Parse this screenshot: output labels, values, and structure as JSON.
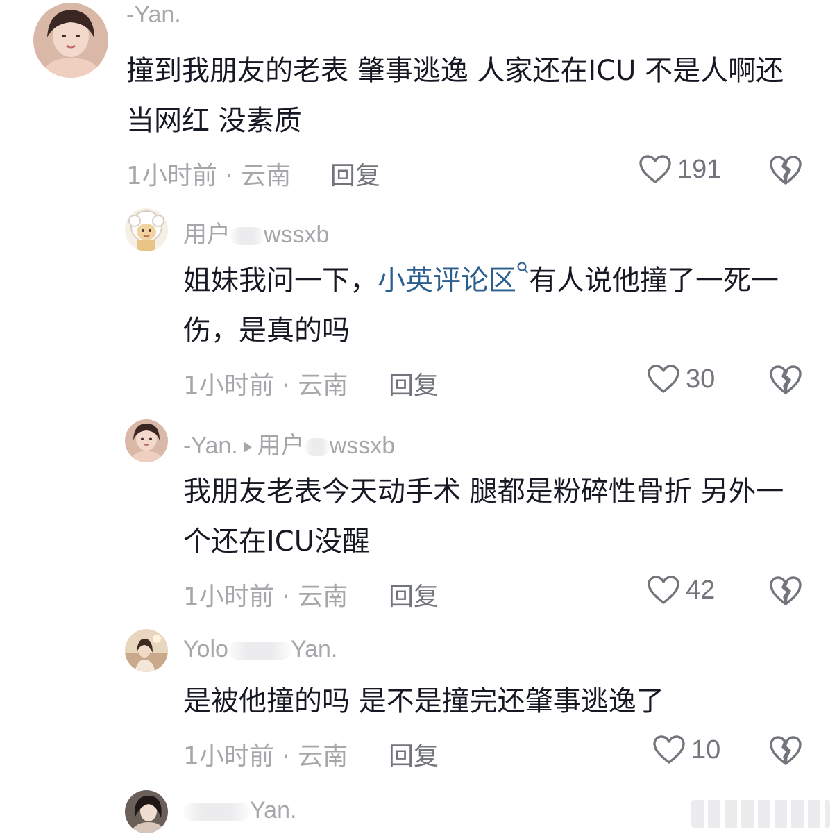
{
  "comments": [
    {
      "username": "-Yan.",
      "content": "撞到我朋友的老表 肇事逃逸 人家还在ICU 不是人啊还当网红 没素质",
      "meta": "1小时前 · 云南",
      "reply_label": "回复",
      "likes": "191",
      "avatar_icon": "user-avatar"
    },
    {
      "username_prefix": "用户",
      "username_suffix": "wssxb",
      "content_before": "姐妹我问一下，",
      "mention": "小英评论区",
      "content_after": "有人说他撞了一死一伤，是真的吗",
      "meta": "1小时前 · 云南",
      "reply_label": "回复",
      "likes": "30",
      "avatar_icon": "sheep-avatar"
    },
    {
      "username": "-Yan.",
      "reply_to_prefix": "用户",
      "reply_to_suffix": "wssxb",
      "content": "我朋友老表今天动手术 腿都是粉碎性骨折 另外一个还在ICU没醒",
      "meta": "1小时前 · 云南",
      "reply_label": "回复",
      "likes": "42",
      "avatar_icon": "user-avatar"
    },
    {
      "username_prefix": "Yolo",
      "username_suffix": "Yan.",
      "content": "是被他撞的吗 是不是撞完还肇事逃逸了",
      "meta": "1小时前 · 云南",
      "reply_label": "回复",
      "likes": "10",
      "avatar_icon": "user-avatar"
    },
    {
      "username_suffix": "Yan.",
      "avatar_icon": "user-avatar"
    }
  ],
  "colors": {
    "text": "#161823",
    "meta": "#a6a7ab",
    "action": "#73757c",
    "link": "#2b5f8e"
  }
}
